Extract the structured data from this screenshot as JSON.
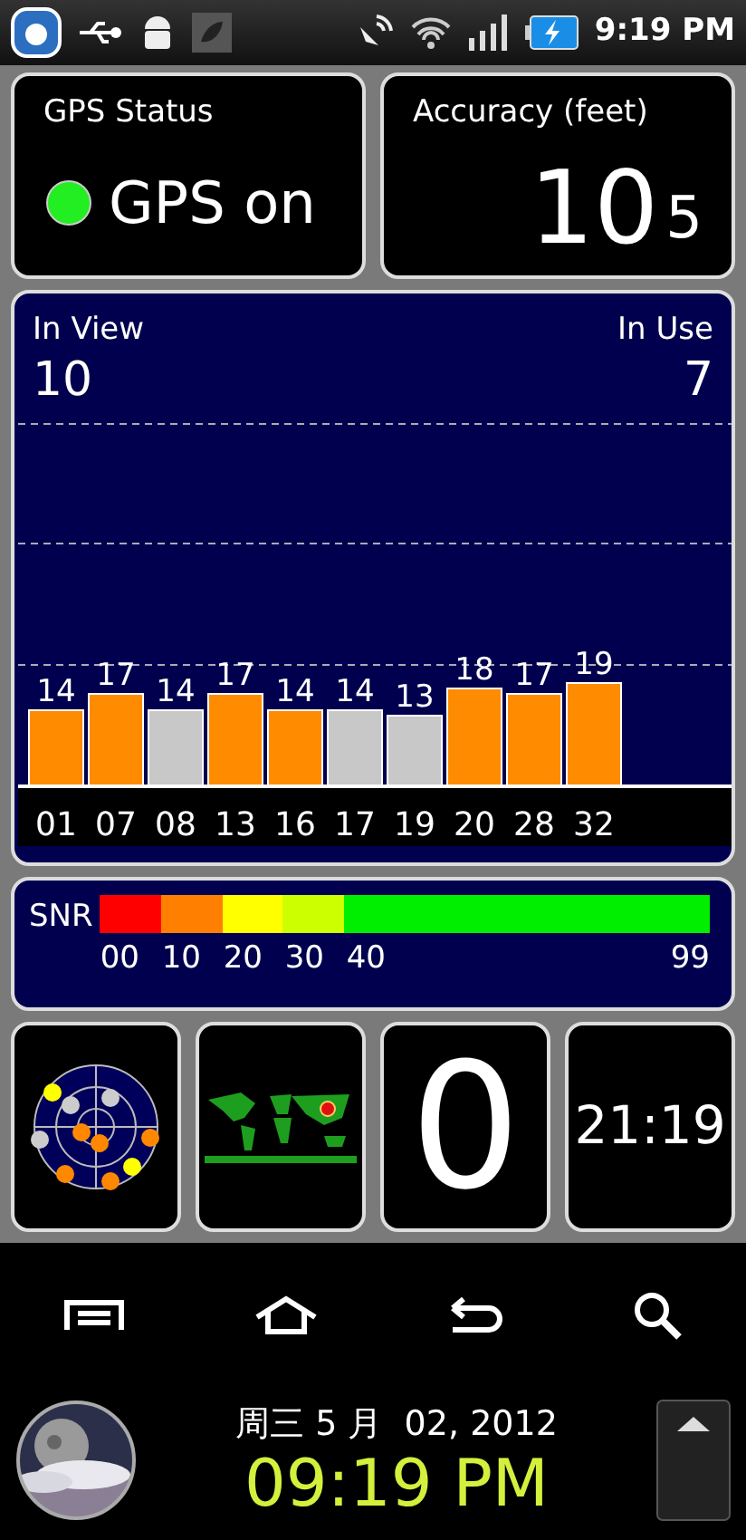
{
  "status_bar": {
    "time": "9:19 PM"
  },
  "gps_status": {
    "title": "GPS Status",
    "text": "GPS on",
    "on": true
  },
  "accuracy": {
    "title": "Accuracy (feet)",
    "value": "10",
    "fraction": "5"
  },
  "satellites": {
    "in_view_label": "In View",
    "in_view": "10",
    "in_use_label": "In Use",
    "in_use": "7",
    "chart_data": {
      "type": "bar",
      "categories": [
        "01",
        "07",
        "08",
        "13",
        "16",
        "17",
        "19",
        "20",
        "28",
        "32"
      ],
      "data_labels": true,
      "series": [
        {
          "color": "#ff8c00",
          "values": [
            14,
            17,
            null,
            17,
            14,
            null,
            null,
            18,
            17,
            19
          ]
        },
        {
          "color": "#c8c8c8",
          "values": [
            null,
            null,
            14,
            null,
            null,
            14,
            13,
            null,
            null,
            null
          ]
        }
      ]
    }
  },
  "snr": {
    "label": "SNR",
    "segments": [
      {
        "color": "#ff0000"
      },
      {
        "color": "#ff8000"
      },
      {
        "color": "#ffff00"
      },
      {
        "color": "#ccff00"
      },
      {
        "color": "#00ee00"
      }
    ],
    "ticks": [
      "00",
      "10",
      "20",
      "30",
      "40",
      "99"
    ]
  },
  "tiles": [
    {
      "kind": "skyplot"
    },
    {
      "kind": "map"
    },
    {
      "kind": "text",
      "value": "0"
    },
    {
      "kind": "clock",
      "value": "21:19"
    }
  ],
  "widget": {
    "date": "周三 5 月  02, 2012",
    "time": "09:19 PM"
  }
}
